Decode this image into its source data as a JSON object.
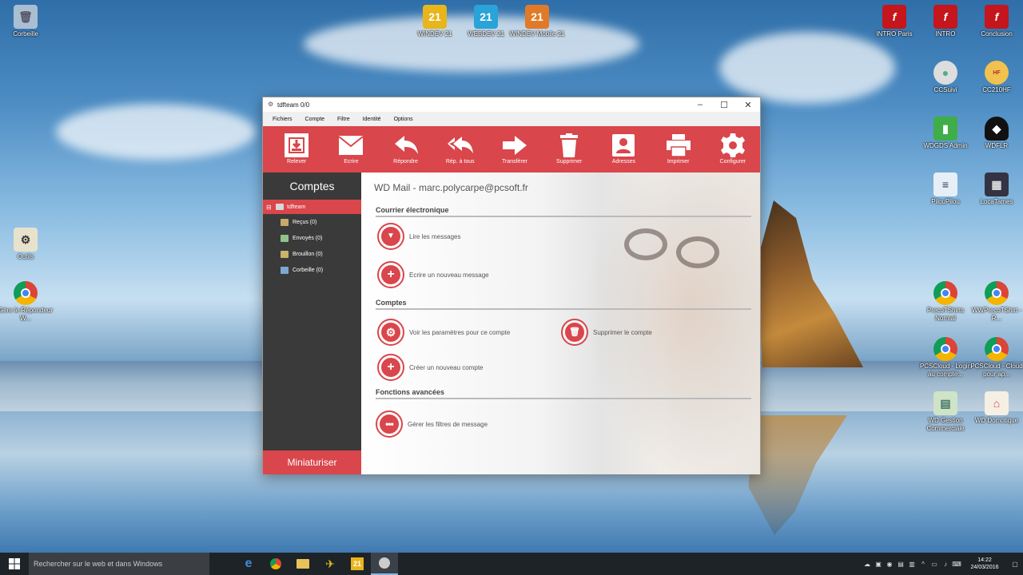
{
  "desktop": {
    "icons_left": [
      {
        "label": "Corbeille",
        "icon": "recycle-bin-icon"
      },
      {
        "label": "Outils",
        "icon": "tools-icon"
      },
      {
        "label": "Gère le Répondeur W...",
        "icon": "chrome-icon"
      }
    ],
    "icons_top": [
      {
        "label": "WINDEV 21",
        "badge": "21",
        "color": "#e8b51c"
      },
      {
        "label": "WEBDEV 21",
        "badge": "21",
        "color": "#2aa3d8"
      },
      {
        "label": "WINDEV Mobile 21",
        "badge": "21",
        "color": "#e07a28"
      }
    ],
    "icons_right": [
      {
        "label": "INTRO Paris",
        "icon": "flash-icon"
      },
      {
        "label": "INTRO",
        "icon": "flash-icon"
      },
      {
        "label": "Conclusion",
        "icon": "flash-icon"
      },
      {
        "label": "CCSuivi",
        "icon": "cc-icon"
      },
      {
        "label": "CC210HF",
        "icon": "cc-hf-icon"
      },
      {
        "label": "WDGDS Admin",
        "icon": "wdgds-icon"
      },
      {
        "label": "WDFLR",
        "icon": "helmet-icon"
      },
      {
        "label": "PilouPilou",
        "icon": "mixer-icon"
      },
      {
        "label": "LocaTames",
        "icon": "building-icon"
      },
      {
        "label": "PrecoTShirts Normal",
        "icon": "chrome-icon"
      },
      {
        "label": "WWPrecoTShirt - R...",
        "icon": "chrome-icon"
      },
      {
        "label": "PCSCloud - Login au compte...",
        "icon": "chrome-icon"
      },
      {
        "label": "PCSCloud - Cloud pour ap...",
        "icon": "chrome-icon"
      },
      {
        "label": "WD Gestion Commerciale",
        "icon": "gestion-icon"
      },
      {
        "label": "WD Domotique",
        "icon": "house-icon"
      }
    ]
  },
  "window": {
    "title": "tdfteam 0/0",
    "menu": [
      "Fichiers",
      "Compte",
      "Filtre",
      "Identité",
      "Options"
    ],
    "toolbar": [
      {
        "label": "Relever",
        "icon": "download-icon"
      },
      {
        "label": "Ecrire",
        "icon": "envelope-icon"
      },
      {
        "label": "Répondre",
        "icon": "reply-icon"
      },
      {
        "label": "Rép. à tous",
        "icon": "reply-all-icon"
      },
      {
        "label": "Transférer",
        "icon": "forward-icon"
      },
      {
        "label": "Supprimer",
        "icon": "trash-icon"
      },
      {
        "label": "Adresses",
        "icon": "contact-card-icon"
      },
      {
        "label": "Imprimer",
        "icon": "printer-icon"
      },
      {
        "label": "Configurer",
        "icon": "gear-icon"
      }
    ],
    "sidebar": {
      "title": "Comptes",
      "root": "tdfteam",
      "folders": [
        {
          "label": "Reçus (0)",
          "color": "#c8a96a"
        },
        {
          "label": "Envoyés (0)",
          "color": "#8fc38a"
        },
        {
          "label": "Brouillon (0)",
          "color": "#c8b46a"
        },
        {
          "label": "Corbeille (0)",
          "color": "#7fa8d0"
        }
      ],
      "minimize": "Miniaturiser"
    },
    "main": {
      "title": "WD Mail - marc.polycarpe@pcsoft.fr",
      "sections": {
        "mail": "Courrier électronique",
        "accounts": "Comptes",
        "advanced": "Fonctions avancées"
      },
      "actions": {
        "read": "Lire les messages",
        "write": "Ecrire un nouveau message",
        "settings": "Voir les paramètres pour ce compte",
        "delete_account": "Supprimer le compte",
        "create_account": "Créer un nouveau compte",
        "filters": "Gérer les filtres de message"
      }
    }
  },
  "taskbar": {
    "search_placeholder": "Rechercher sur le web et dans Windows",
    "time": "14:22",
    "date": "24/03/2016",
    "badge": "21"
  },
  "colors": {
    "accent": "#d9464b",
    "sidebar": "#3a3a3a"
  }
}
